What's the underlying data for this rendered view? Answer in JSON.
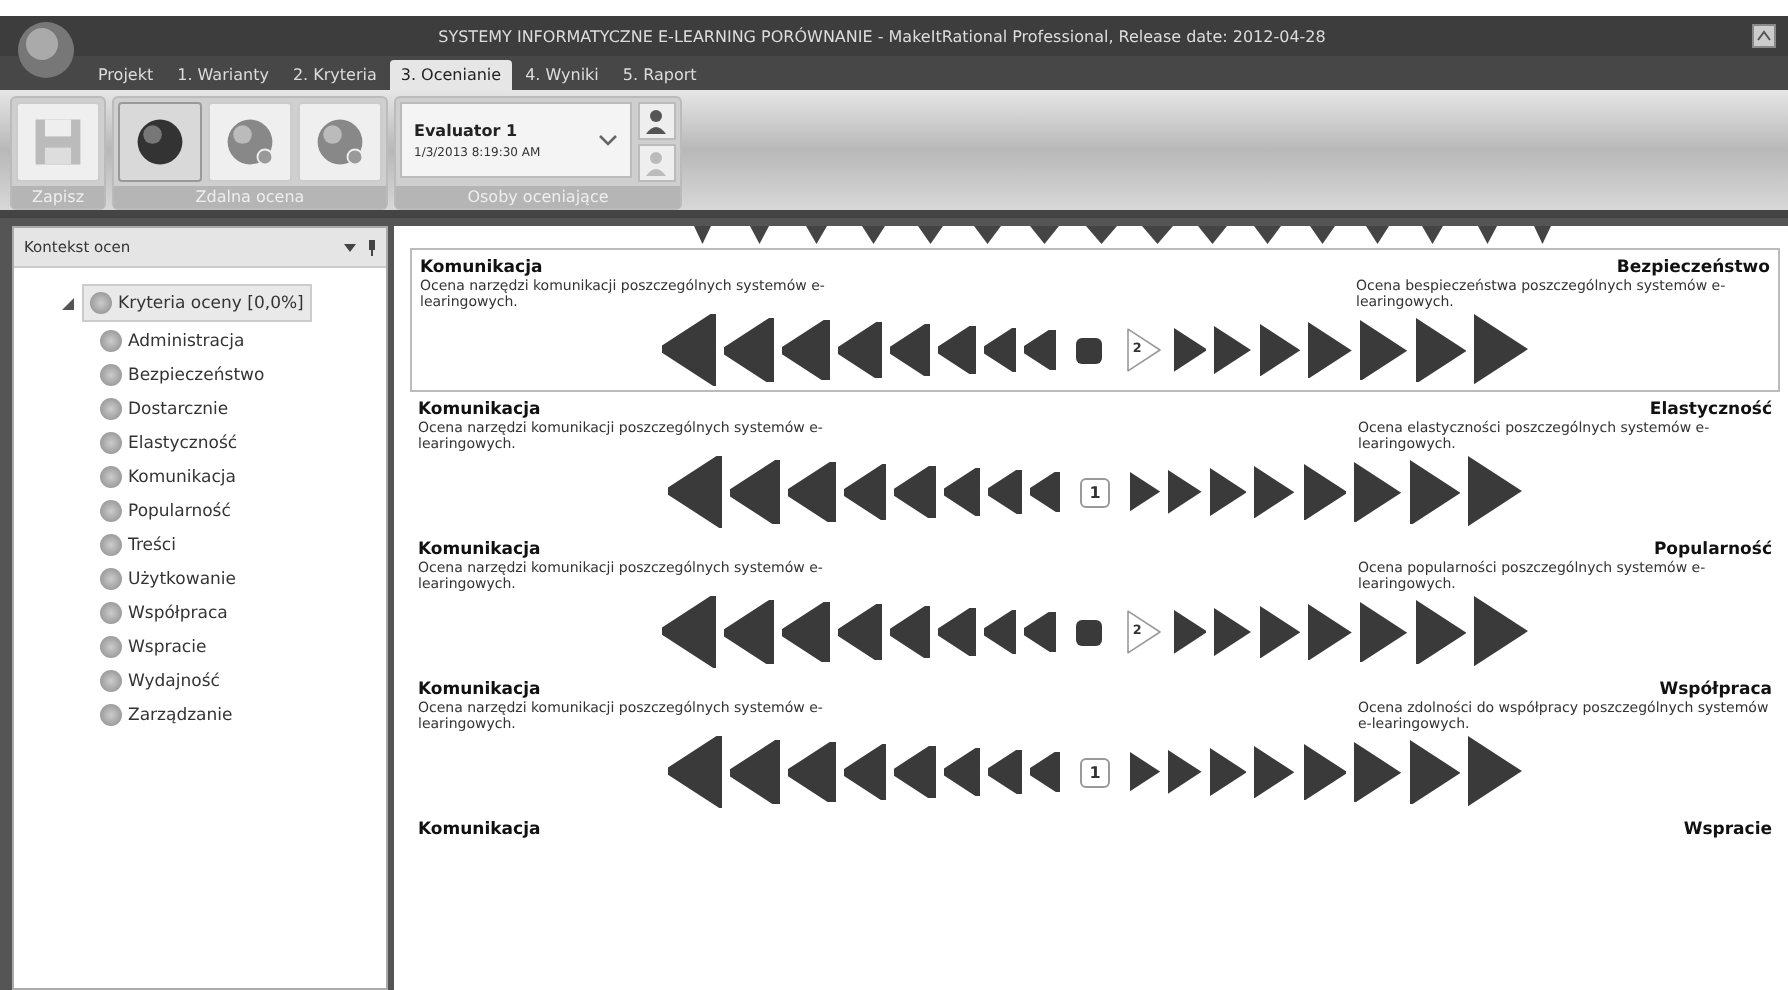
{
  "window": {
    "title": "SYSTEMY INFORMATYCZNE E-LEARNING PORÓWNANIE - MakeItRational Professional, Release date: 2012-04-28"
  },
  "tabs": [
    {
      "label": "Projekt",
      "selected": false
    },
    {
      "label": "1. Warianty",
      "selected": false
    },
    {
      "label": "2. Kryteria",
      "selected": false
    },
    {
      "label": "3. Ocenianie",
      "selected": true
    },
    {
      "label": "4. Wyniki",
      "selected": false
    },
    {
      "label": "5. Raport",
      "selected": false
    }
  ],
  "ribbon": {
    "groups": [
      {
        "label": "Zapisz",
        "kind": "save",
        "buttons": [
          {
            "disabled": true
          }
        ]
      },
      {
        "label": "Zdalna ocena",
        "kind": "globes",
        "buttons": [
          {
            "pressed": true
          },
          {
            "pressed": false
          },
          {
            "pressed": false
          }
        ]
      },
      {
        "label": "Osoby oceniające",
        "kind": "evaluator",
        "evaluator": "Evaluator 1",
        "date": "1/3/2013 8:19:30 AM",
        "buttons": [
          {
            "disabled": false
          },
          {
            "disabled": true
          }
        ]
      }
    ]
  },
  "sidebar": {
    "title": "Kontekst ocen",
    "tree": [
      {
        "label": "Kryteria oceny  [0,0%]",
        "selected": true,
        "expanded": true,
        "children": [
          {
            "label": "Administracja",
            "selected": false
          },
          {
            "label": "Bezpieczeństwo",
            "selected": false
          },
          {
            "label": "Dostarcznie",
            "selected": false
          },
          {
            "label": "Elastyczność",
            "selected": false
          },
          {
            "label": "Komunikacja",
            "selected": false
          },
          {
            "label": "Popularność",
            "selected": false
          },
          {
            "label": "Treści",
            "selected": false
          },
          {
            "label": "Użytkowanie",
            "selected": false
          },
          {
            "label": "Współpraca",
            "selected": false
          },
          {
            "label": "Wspracie",
            "selected": false
          },
          {
            "label": "Wydajność",
            "selected": false
          },
          {
            "label": "Zarządzanie",
            "selected": false
          }
        ]
      }
    ]
  },
  "comparisons": [
    {
      "left": "Komunikacja",
      "left_desc": "Ocena narzędzi komunikacji poszczególnych systemów e-learingowych.",
      "right": "Bezpieczeństwo",
      "right_desc": "Ocena bespieczeństwa poszczególnych systemów e-learingowych.",
      "selected": true,
      "selected_label": "2",
      "equal": false
    },
    {
      "left": "Komunikacja",
      "left_desc": "Ocena narzędzi komunikacji poszczególnych systemów e-learingowych.",
      "right": "Elastyczność",
      "right_desc": "Ocena elastyczności poszczególnych systemów e-learingowych.",
      "selected": false,
      "selected_label": "1",
      "equal": true
    },
    {
      "left": "Komunikacja",
      "left_desc": "Ocena narzędzi komunikacji poszczególnych systemów e-learingowych.",
      "right": "Popularność",
      "right_desc": "Ocena popularności poszczególnych systemów e-learingowych.",
      "selected": false,
      "selected_label": "2",
      "equal": false
    },
    {
      "left": "Komunikacja",
      "left_desc": "Ocena narzędzi komunikacji poszczególnych systemów e-learingowych.",
      "right": "Współpraca",
      "right_desc": "Ocena zdolności do współpracy poszczególnych systemów e-learingowych.",
      "selected": false,
      "selected_label": "1",
      "equal": true
    },
    {
      "left": "Komunikacja",
      "right": "Wspracie",
      "selected": false
    }
  ]
}
